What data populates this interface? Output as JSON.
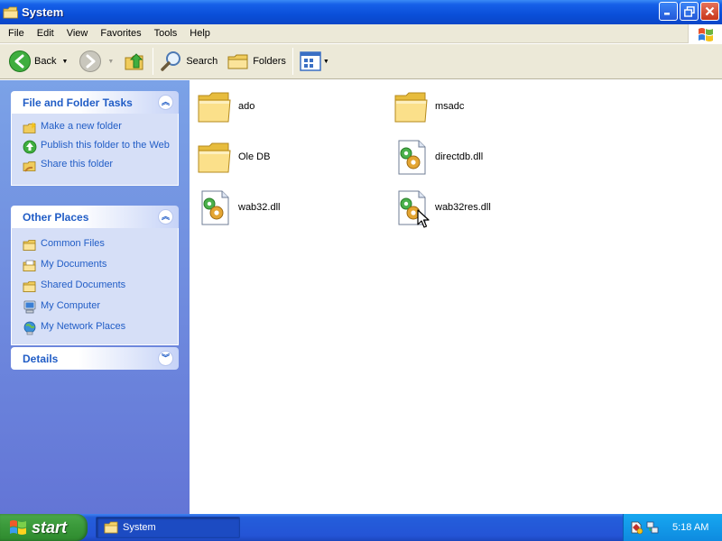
{
  "window": {
    "title": "System"
  },
  "menubar": {
    "items": [
      "File",
      "Edit",
      "View",
      "Favorites",
      "Tools",
      "Help"
    ]
  },
  "toolbar": {
    "back_label": "Back",
    "search_label": "Search",
    "folders_label": "Folders"
  },
  "taskpane": {
    "file_tasks": {
      "title": "File and Folder Tasks",
      "items": [
        {
          "label": "Make a new folder",
          "icon": "new-folder-icon"
        },
        {
          "label": "Publish this folder to the Web",
          "icon": "publish-web-icon"
        },
        {
          "label": "Share this folder",
          "icon": "share-folder-icon"
        }
      ]
    },
    "other_places": {
      "title": "Other Places",
      "items": [
        {
          "label": "Common Files",
          "icon": "folder-icon"
        },
        {
          "label": "My Documents",
          "icon": "my-documents-icon"
        },
        {
          "label": "Shared Documents",
          "icon": "folder-icon"
        },
        {
          "label": "My Computer",
          "icon": "my-computer-icon"
        },
        {
          "label": "My Network Places",
          "icon": "network-places-icon"
        }
      ]
    },
    "details": {
      "title": "Details"
    }
  },
  "files": [
    {
      "name": "ado",
      "type": "folder"
    },
    {
      "name": "msadc",
      "type": "folder"
    },
    {
      "name": "Ole DB",
      "type": "folder"
    },
    {
      "name": "directdb.dll",
      "type": "dll"
    },
    {
      "name": "wab32.dll",
      "type": "dll"
    },
    {
      "name": "wab32res.dll",
      "type": "dll"
    }
  ],
  "taskbar": {
    "start_label": "start",
    "window_button_label": "System",
    "clock": "5:18 AM"
  },
  "colors": {
    "titlebar": "#0a4fd9",
    "taskpane_link": "#215dc6",
    "taskbar": "#245edb",
    "start_button": "#3c9b3c"
  }
}
